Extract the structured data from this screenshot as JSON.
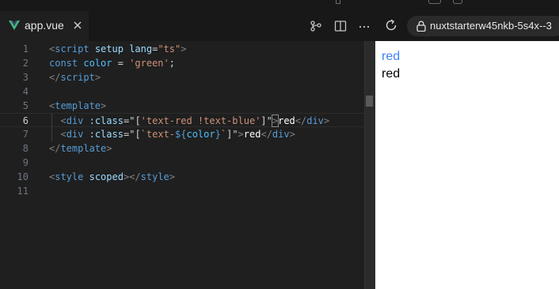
{
  "tab": {
    "label": "app.vue",
    "icon": "vue-icon",
    "close_icon": "close-icon",
    "accent": "#41b883"
  },
  "header_icons": [
    {
      "name": "source-control-icon"
    },
    {
      "name": "split-editor-icon"
    },
    {
      "name": "more-actions-icon"
    },
    {
      "name": "reload-icon"
    }
  ],
  "url_bar": {
    "text": "nuxtstarterw45nkb-5s4x--3",
    "icon": "lock-icon"
  },
  "editor": {
    "active_line": 6,
    "lines": [
      {
        "n": "1",
        "tokens": [
          {
            "t": "<",
            "c": "c-punc"
          },
          {
            "t": "script",
            "c": "c-tag"
          },
          {
            "t": " ",
            "c": "c-plain"
          },
          {
            "t": "setup",
            "c": "c-attr"
          },
          {
            "t": " ",
            "c": "c-plain"
          },
          {
            "t": "lang",
            "c": "c-attr"
          },
          {
            "t": "=",
            "c": "c-plain"
          },
          {
            "t": "\"ts\"",
            "c": "c-str"
          },
          {
            "t": ">",
            "c": "c-punc"
          }
        ]
      },
      {
        "n": "2",
        "tokens": [
          {
            "t": "const",
            "c": "c-kw"
          },
          {
            "t": " ",
            "c": "c-plain"
          },
          {
            "t": "color",
            "c": "c-var"
          },
          {
            "t": " = ",
            "c": "c-plain"
          },
          {
            "t": "'green'",
            "c": "c-str"
          },
          {
            "t": ";",
            "c": "c-plain"
          }
        ]
      },
      {
        "n": "3",
        "tokens": [
          {
            "t": "</",
            "c": "c-punc"
          },
          {
            "t": "script",
            "c": "c-tag"
          },
          {
            "t": ">",
            "c": "c-punc"
          }
        ]
      },
      {
        "n": "4",
        "tokens": []
      },
      {
        "n": "5",
        "tokens": [
          {
            "t": "<",
            "c": "c-punc"
          },
          {
            "t": "template",
            "c": "c-tag"
          },
          {
            "t": ">",
            "c": "c-punc"
          }
        ]
      },
      {
        "n": "6",
        "tokens": [
          {
            "t": "  ",
            "c": "c-plain"
          },
          {
            "t": "<",
            "c": "c-punc"
          },
          {
            "t": "div",
            "c": "c-tag"
          },
          {
            "t": " ",
            "c": "c-plain"
          },
          {
            "t": ":class",
            "c": "c-attr"
          },
          {
            "t": "=",
            "c": "c-plain"
          },
          {
            "t": "\"",
            "c": "c-plain"
          },
          {
            "t": "[",
            "c": "c-plain"
          },
          {
            "t": "'text-red !text-blue'",
            "c": "c-str"
          },
          {
            "t": "]",
            "c": "c-plain"
          },
          {
            "t": "\"",
            "c": "c-plain"
          },
          {
            "t": ">",
            "c": "c-punc bracket-hl"
          },
          {
            "t": "red",
            "c": "c-white"
          },
          {
            "t": "</",
            "c": "c-punc"
          },
          {
            "t": "div",
            "c": "c-tag"
          },
          {
            "t": ">",
            "c": "c-punc"
          }
        ]
      },
      {
        "n": "7",
        "tokens": [
          {
            "t": "  ",
            "c": "c-plain"
          },
          {
            "t": "<",
            "c": "c-punc"
          },
          {
            "t": "div",
            "c": "c-tag"
          },
          {
            "t": " ",
            "c": "c-plain"
          },
          {
            "t": ":class",
            "c": "c-attr"
          },
          {
            "t": "=",
            "c": "c-plain"
          },
          {
            "t": "\"",
            "c": "c-plain"
          },
          {
            "t": "[",
            "c": "c-plain"
          },
          {
            "t": "`text-",
            "c": "c-str"
          },
          {
            "t": "${",
            "c": "c-kw"
          },
          {
            "t": "color",
            "c": "c-var"
          },
          {
            "t": "}",
            "c": "c-kw"
          },
          {
            "t": "`",
            "c": "c-str"
          },
          {
            "t": "]",
            "c": "c-plain"
          },
          {
            "t": "\"",
            "c": "c-plain"
          },
          {
            "t": ">",
            "c": "c-punc"
          },
          {
            "t": "red",
            "c": "c-white"
          },
          {
            "t": "</",
            "c": "c-punc"
          },
          {
            "t": "div",
            "c": "c-tag"
          },
          {
            "t": ">",
            "c": "c-punc"
          }
        ]
      },
      {
        "n": "8",
        "tokens": [
          {
            "t": "</",
            "c": "c-punc"
          },
          {
            "t": "template",
            "c": "c-tag"
          },
          {
            "t": ">",
            "c": "c-punc"
          }
        ]
      },
      {
        "n": "9",
        "tokens": []
      },
      {
        "n": "10",
        "tokens": [
          {
            "t": "<",
            "c": "c-punc"
          },
          {
            "t": "style",
            "c": "c-tag"
          },
          {
            "t": " ",
            "c": "c-plain"
          },
          {
            "t": "scoped",
            "c": "c-attr"
          },
          {
            "t": ">",
            "c": "c-punc"
          },
          {
            "t": "</",
            "c": "c-punc"
          },
          {
            "t": "style",
            "c": "c-tag"
          },
          {
            "t": ">",
            "c": "c-punc"
          }
        ]
      },
      {
        "n": "11",
        "tokens": []
      }
    ]
  },
  "preview": {
    "lines": [
      {
        "text": "red",
        "color": "#3b82f6"
      },
      {
        "text": "red",
        "color": "#000000"
      }
    ]
  }
}
